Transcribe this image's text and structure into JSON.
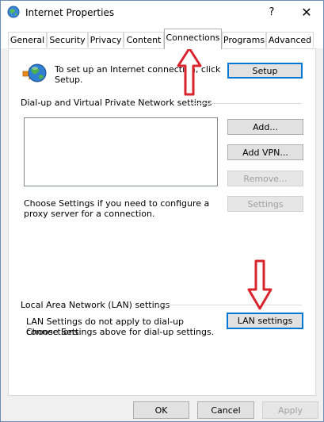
{
  "window": {
    "title": "Internet Properties",
    "help_label": "?",
    "close_label": "✕"
  },
  "tabs": [
    {
      "label": "General"
    },
    {
      "label": "Security"
    },
    {
      "label": "Privacy"
    },
    {
      "label": "Content"
    },
    {
      "label": "Connections"
    },
    {
      "label": "Programs"
    },
    {
      "label": "Advanced"
    }
  ],
  "active_tab": "Connections",
  "intro": {
    "text": "To set up an Internet connection, click Setup.",
    "setup_button": "Setup"
  },
  "dialup": {
    "section_label": "Dial-up and Virtual Private Network settings",
    "add_button": "Add...",
    "add_vpn_button": "Add VPN...",
    "remove_button": "Remove...",
    "settings_button": "Settings",
    "proxy_text": "Choose Settings if you need to configure a proxy server for a connection."
  },
  "lan": {
    "section_label": "Local Area Network (LAN) settings",
    "info_line1": "LAN Settings do not apply to dial-up connections.",
    "info_line2": "Choose Settings above for dial-up settings.",
    "lan_settings_button": "LAN settings"
  },
  "footer": {
    "ok_button": "OK",
    "cancel_button": "Cancel",
    "apply_button": "Apply"
  },
  "colors": {
    "accent_border": "#0078d7",
    "annotation_arrow": "#d9232d"
  },
  "icons": {
    "title_icon": "internet-globe-icon",
    "setup_icon": "globe-network-icon"
  }
}
